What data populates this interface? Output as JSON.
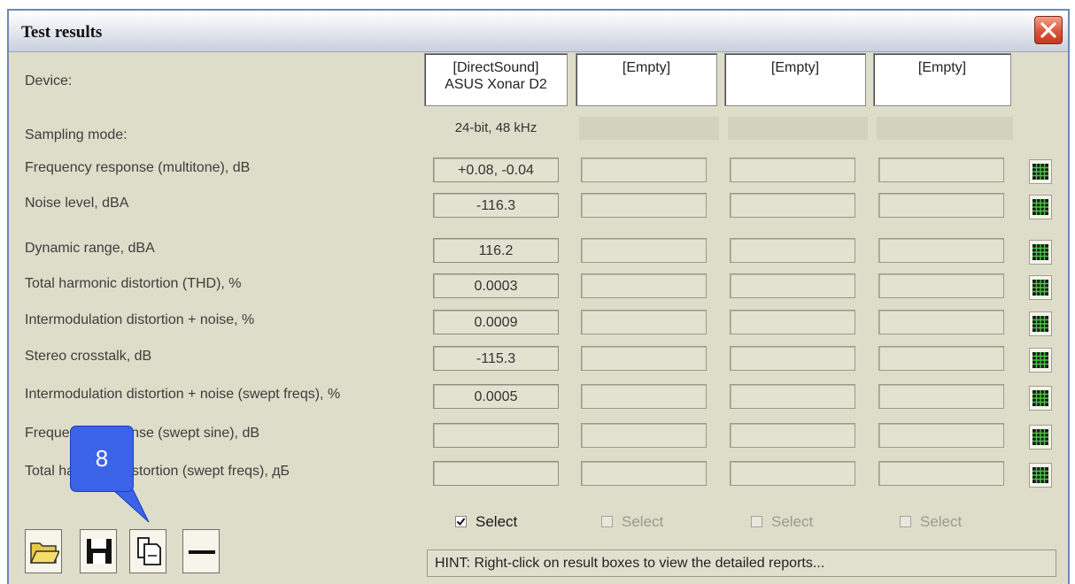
{
  "window": {
    "title": "Test results"
  },
  "labels": {
    "device": "Device:",
    "sampling_mode": "Sampling mode:"
  },
  "devices": [
    {
      "line1": "[DirectSound]",
      "line2": "ASUS Xonar D2"
    },
    {
      "line1": "[Empty]",
      "line2": ""
    },
    {
      "line1": "[Empty]",
      "line2": ""
    },
    {
      "line1": "[Empty]",
      "line2": ""
    }
  ],
  "sampling": [
    "24-bit, 48 kHz",
    "",
    "",
    ""
  ],
  "rows": [
    {
      "label": "Frequency response (multitone), dB",
      "values": [
        "+0.08, -0.04",
        "",
        "",
        ""
      ]
    },
    {
      "label": "Noise level, dBA",
      "values": [
        "-116.3",
        "",
        "",
        ""
      ]
    },
    {
      "label": "Dynamic range, dBA",
      "values": [
        "116.2",
        "",
        "",
        ""
      ]
    },
    {
      "label": "Total harmonic distortion (THD), %",
      "values": [
        "0.0003",
        "",
        "",
        ""
      ]
    },
    {
      "label": "Intermodulation distortion + noise, %",
      "values": [
        "0.0009",
        "",
        "",
        ""
      ]
    },
    {
      "label": "Stereo crosstalk, dB",
      "values": [
        "-115.3",
        "",
        "",
        ""
      ]
    },
    {
      "label": "Intermodulation distortion + noise (swept freqs), %",
      "values": [
        "0.0005",
        "",
        "",
        ""
      ]
    },
    {
      "label": "Frequency response (swept sine), dB",
      "values": [
        "",
        "",
        "",
        ""
      ]
    },
    {
      "label": "Total harmonic distortion (swept freqs), дБ",
      "values": [
        "",
        "",
        "",
        ""
      ]
    }
  ],
  "select": [
    {
      "label": "Select",
      "checked": true,
      "enabled": true
    },
    {
      "label": "Select",
      "checked": false,
      "enabled": false
    },
    {
      "label": "Select",
      "checked": false,
      "enabled": false
    },
    {
      "label": "Select",
      "checked": false,
      "enabled": false
    }
  ],
  "hint": "HINT: Right-click on result boxes to view the detailed reports...",
  "toolbar": [
    "open-folder-icon",
    "save-disk-icon",
    "copy-icon",
    "minus-icon"
  ],
  "callout": {
    "number": "8"
  },
  "colors": {
    "panel": "#ddddc9",
    "callout": "#3a63e8",
    "close": "#d9563a"
  }
}
